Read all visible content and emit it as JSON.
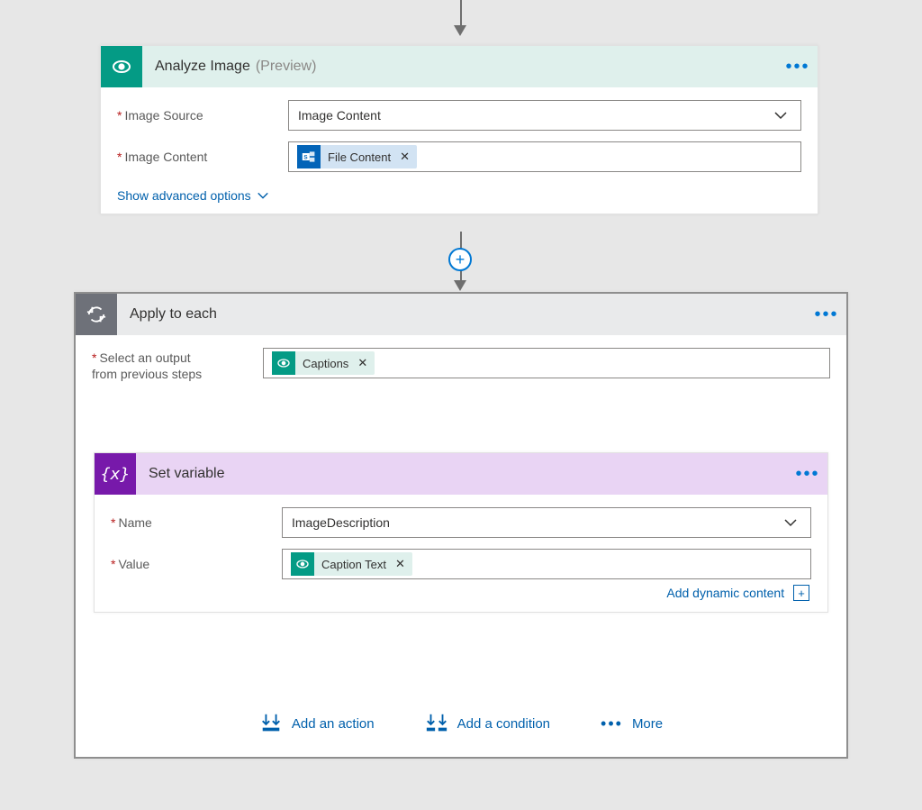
{
  "analyze": {
    "title": "Analyze Image",
    "preview": "(Preview)",
    "fields": {
      "image_source_label": "Image Source",
      "image_source_value": "Image Content",
      "image_content_label": "Image Content",
      "image_content_chip": "File Content"
    },
    "advanced_link": "Show advanced options"
  },
  "foreach": {
    "title": "Apply to each",
    "select_label_line1": "Select an output",
    "select_label_line2": "from previous steps",
    "select_chip": "Captions"
  },
  "setvar": {
    "title": "Set variable",
    "name_label": "Name",
    "name_value": "ImageDescription",
    "value_label": "Value",
    "value_chip": "Caption Text",
    "add_dynamic": "Add dynamic content"
  },
  "actions": {
    "add_action": "Add an action",
    "add_condition": "Add a condition",
    "more": "More"
  }
}
